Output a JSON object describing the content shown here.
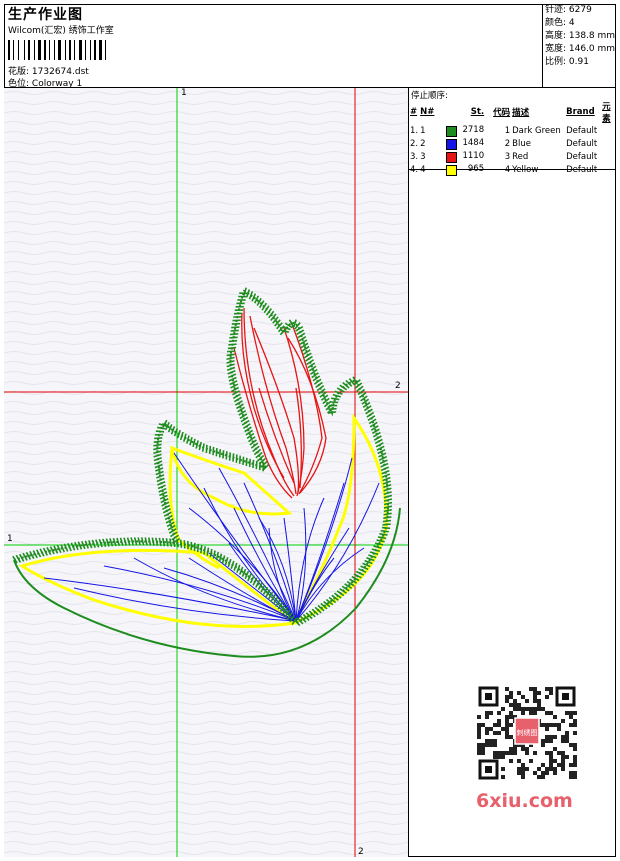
{
  "header": {
    "title": "生产作业图",
    "subtitle": "Wilcom(汇宏) 绣饰工作室",
    "design_label": "花版:",
    "design_value": "1732674.dst",
    "colorway_label": "色位:",
    "colorway_value": "Colorway 1"
  },
  "stats": {
    "stitches": "针迹: 6279",
    "colors": "颜色: 4",
    "height": "高度: 138.8 mm",
    "width": "宽度: 146.0 mm",
    "scale": "比例: 0.91"
  },
  "stop_sequence": {
    "title": "停止顺序:",
    "headers": [
      "#",
      "N#",
      "St.",
      "代码",
      "描述",
      "Brand",
      "元素"
    ],
    "rows": [
      {
        "num": "1.",
        "n": "1",
        "color": "#1e8c1e",
        "st": "2718",
        "code": "1",
        "desc": "Dark Green",
        "brand": "Default"
      },
      {
        "num": "2.",
        "n": "2",
        "color": "#1414e6",
        "st": "1484",
        "code": "2",
        "desc": "Blue",
        "brand": "Default"
      },
      {
        "num": "3.",
        "n": "3",
        "color": "#e61414",
        "st": "1110",
        "code": "3",
        "desc": "Red",
        "brand": "Default"
      },
      {
        "num": "4.",
        "n": "4",
        "color": "#ffff00",
        "st": "965",
        "code": "4",
        "desc": "Yellow",
        "brand": "Default"
      }
    ]
  },
  "guides": {
    "v1_label": "1",
    "h1_label": "1",
    "h2_label": "2",
    "v2_label": "2"
  },
  "colors": {
    "green_guide": "#00d000",
    "red_guide": "#e00000",
    "dark_green": "#1e8c1e",
    "blue": "#1414e6",
    "red": "#e61414",
    "yellow": "#ffff00"
  },
  "watermark": "6xiu.com",
  "qr_stamp": "刺绣图",
  "icons": [
    "barcode-icon",
    "qr-code-icon"
  ]
}
